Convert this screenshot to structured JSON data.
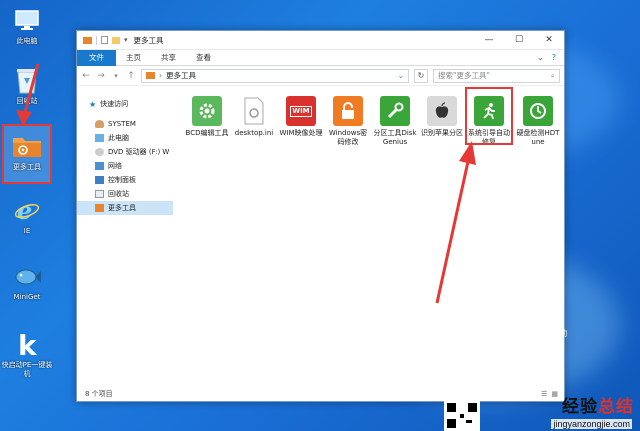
{
  "desktop": {
    "icons": [
      {
        "label": "此电脑"
      },
      {
        "label": "回收站"
      },
      {
        "label": "更多工具"
      },
      {
        "label": "IE"
      },
      {
        "label": "MiniGet"
      },
      {
        "label": "快启动PE一键装机"
      }
    ],
    "brand_tag": "快启动"
  },
  "window": {
    "title": "更多工具",
    "controls": {
      "minimize": "—",
      "maximize": "☐",
      "close": "✕"
    },
    "ribbon_tabs": [
      "文件",
      "主页",
      "共享",
      "查看"
    ],
    "address": {
      "segment": "更多工具"
    },
    "search_placeholder": "搜索\"更多工具\"",
    "nav_pane": [
      {
        "label": "快速访问"
      },
      {
        "label": "SYSTEM"
      },
      {
        "label": "此电脑"
      },
      {
        "label": "DVD 驱动器 (F:) W"
      },
      {
        "label": "网络"
      },
      {
        "label": "控制面板"
      },
      {
        "label": "回收站"
      },
      {
        "label": "更多工具"
      }
    ],
    "files": [
      {
        "label": "BCD编辑工具"
      },
      {
        "label": "desktop.ini"
      },
      {
        "label": "WIM映像处理"
      },
      {
        "label": "Windows密码修改"
      },
      {
        "label": "分区工具DiskGenius"
      },
      {
        "label": "识别苹果分区"
      },
      {
        "label": "系统引导自动修复"
      },
      {
        "label": "硬盘检测HDTune"
      }
    ],
    "wim_badge": "WIM",
    "status": "8 个项目"
  },
  "watermark": {
    "text_a": "经验",
    "text_b": "总结",
    "url": "jingyanzongjie.com"
  },
  "colors": {
    "accent": "#1979ca",
    "highlight": "#e53935",
    "desktop": "#1a6fd6"
  }
}
